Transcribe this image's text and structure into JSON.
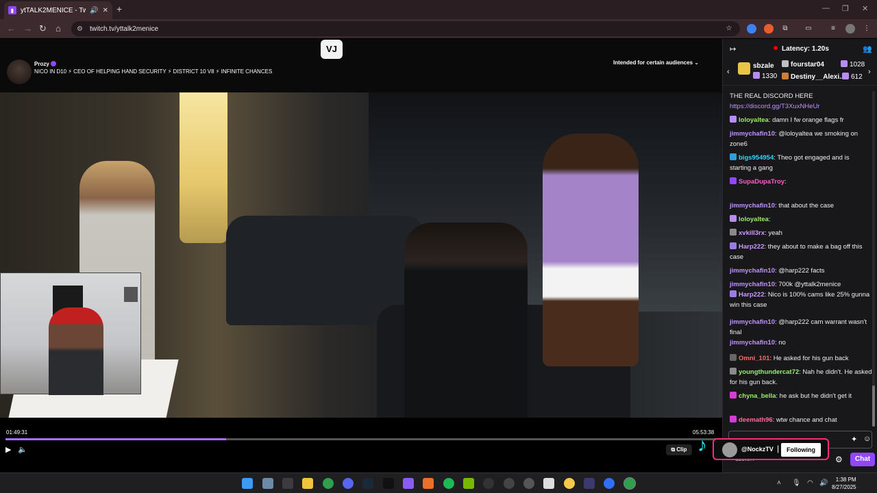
{
  "browser": {
    "tab_title": "ytTALK2MENICE - Twitch",
    "url": "twitch.tv/yttalk2menice"
  },
  "stream": {
    "logo_text": "VJ",
    "channel_name": "Prozy",
    "title": "NICO IN D10 ⚡ CEO OF HELPING HAND SECURITY ⚡ DISTRICT 10 V8 ⚡ INFINITE CHANCES",
    "audience_label": "Intended for certain audiences",
    "elapsed": "01:49:31",
    "duration": "05:53:38",
    "progress_fraction": 0.31,
    "clip_label": "Clip"
  },
  "chat": {
    "latency": "Latency: 1.20s",
    "leaderboard": {
      "first": {
        "name": "sbzale",
        "count": "1330"
      },
      "second": {
        "name": "fourstar04",
        "count": "1028"
      },
      "third": {
        "name": "Destiny__Alexi...",
        "count": "612"
      }
    },
    "messages": [
      {
        "user": "",
        "text": "THE REAL DISCORD HERE",
        "color": "#efeff1",
        "badge": ""
      },
      {
        "user": "",
        "text": "https://discord.gg/T3XuxNHeUr",
        "color": "#bf94ff",
        "badge": ""
      },
      {
        "user": "loloyaltea",
        "text": ": damn I fw orange flags fr",
        "color": "#9aef6a",
        "badge": "#b78cf5"
      },
      {
        "user": "jimmychafin10",
        "text": ": @loloyaltea we smoking on zone6",
        "color": "#bf94ff",
        "badge": ""
      },
      {
        "user": "bigs954954",
        "text": ": Theo got engaged and is starting a gang",
        "color": "#33d6ff",
        "badge": "#2f9ddc"
      },
      {
        "user": "SupaDupaTroy",
        "text": ":",
        "color": "#ff5ccd",
        "badge": "#9147ff"
      },
      {
        "user": "jimmychafin10",
        "text": ": that about the case",
        "color": "#bf94ff",
        "badge": ""
      },
      {
        "user": "loloyaltea",
        "text": ":",
        "color": "#9aef6a",
        "badge": "#b78cf5"
      },
      {
        "user": "xvkill3rx",
        "text": ": yeah",
        "color": "#c99bff",
        "badge": "#8a8a8a"
      },
      {
        "user": "Harp222",
        "text": ": they about to make a bag off this case",
        "color": "#c99bff",
        "badge": "#9a7be0"
      },
      {
        "user": "jimmychafin10",
        "text": ": @harp222 facts",
        "color": "#bf94ff",
        "badge": ""
      },
      {
        "user": "jimmychafin10",
        "text": ": 700k @yttalk2menice",
        "color": "#bf94ff",
        "badge": ""
      },
      {
        "user": "Harp222",
        "text": ": Nico is 100% cams like 25% gunna win this case",
        "color": "#c99bff",
        "badge": "#9a7be0"
      },
      {
        "user": "jimmychafin10",
        "text": ": @harp222 cam warrant wasn't final",
        "color": "#bf94ff",
        "badge": ""
      },
      {
        "user": "jimmychafin10",
        "text": ": no",
        "color": "#bf94ff",
        "badge": ""
      },
      {
        "user": "Omni_101",
        "text": ": He asked for his gun back",
        "color": "#ff6b6b",
        "badge": "#666"
      },
      {
        "user": "youngthundercat72",
        "text": ": Nah he didn't. He asked for his gun back.",
        "color": "#9aef6a",
        "badge": "#8a8a8a"
      },
      {
        "user": "chyna_bella",
        "text": ": he ask but he didn't get it",
        "color": "#9aef6a",
        "badge": "#d63bd6"
      },
      {
        "user": "deemath96",
        "text": ": wtw chance and chat",
        "color": "#ff6b9a",
        "badge": "#d63bd6"
      }
    ],
    "points": "113.5K",
    "chat_button": "Chat"
  },
  "tiktok": {
    "handle": "@NockzTV",
    "button": "Following"
  },
  "taskbar": {
    "time": "1:38 PM",
    "date": "8/27/2025"
  }
}
